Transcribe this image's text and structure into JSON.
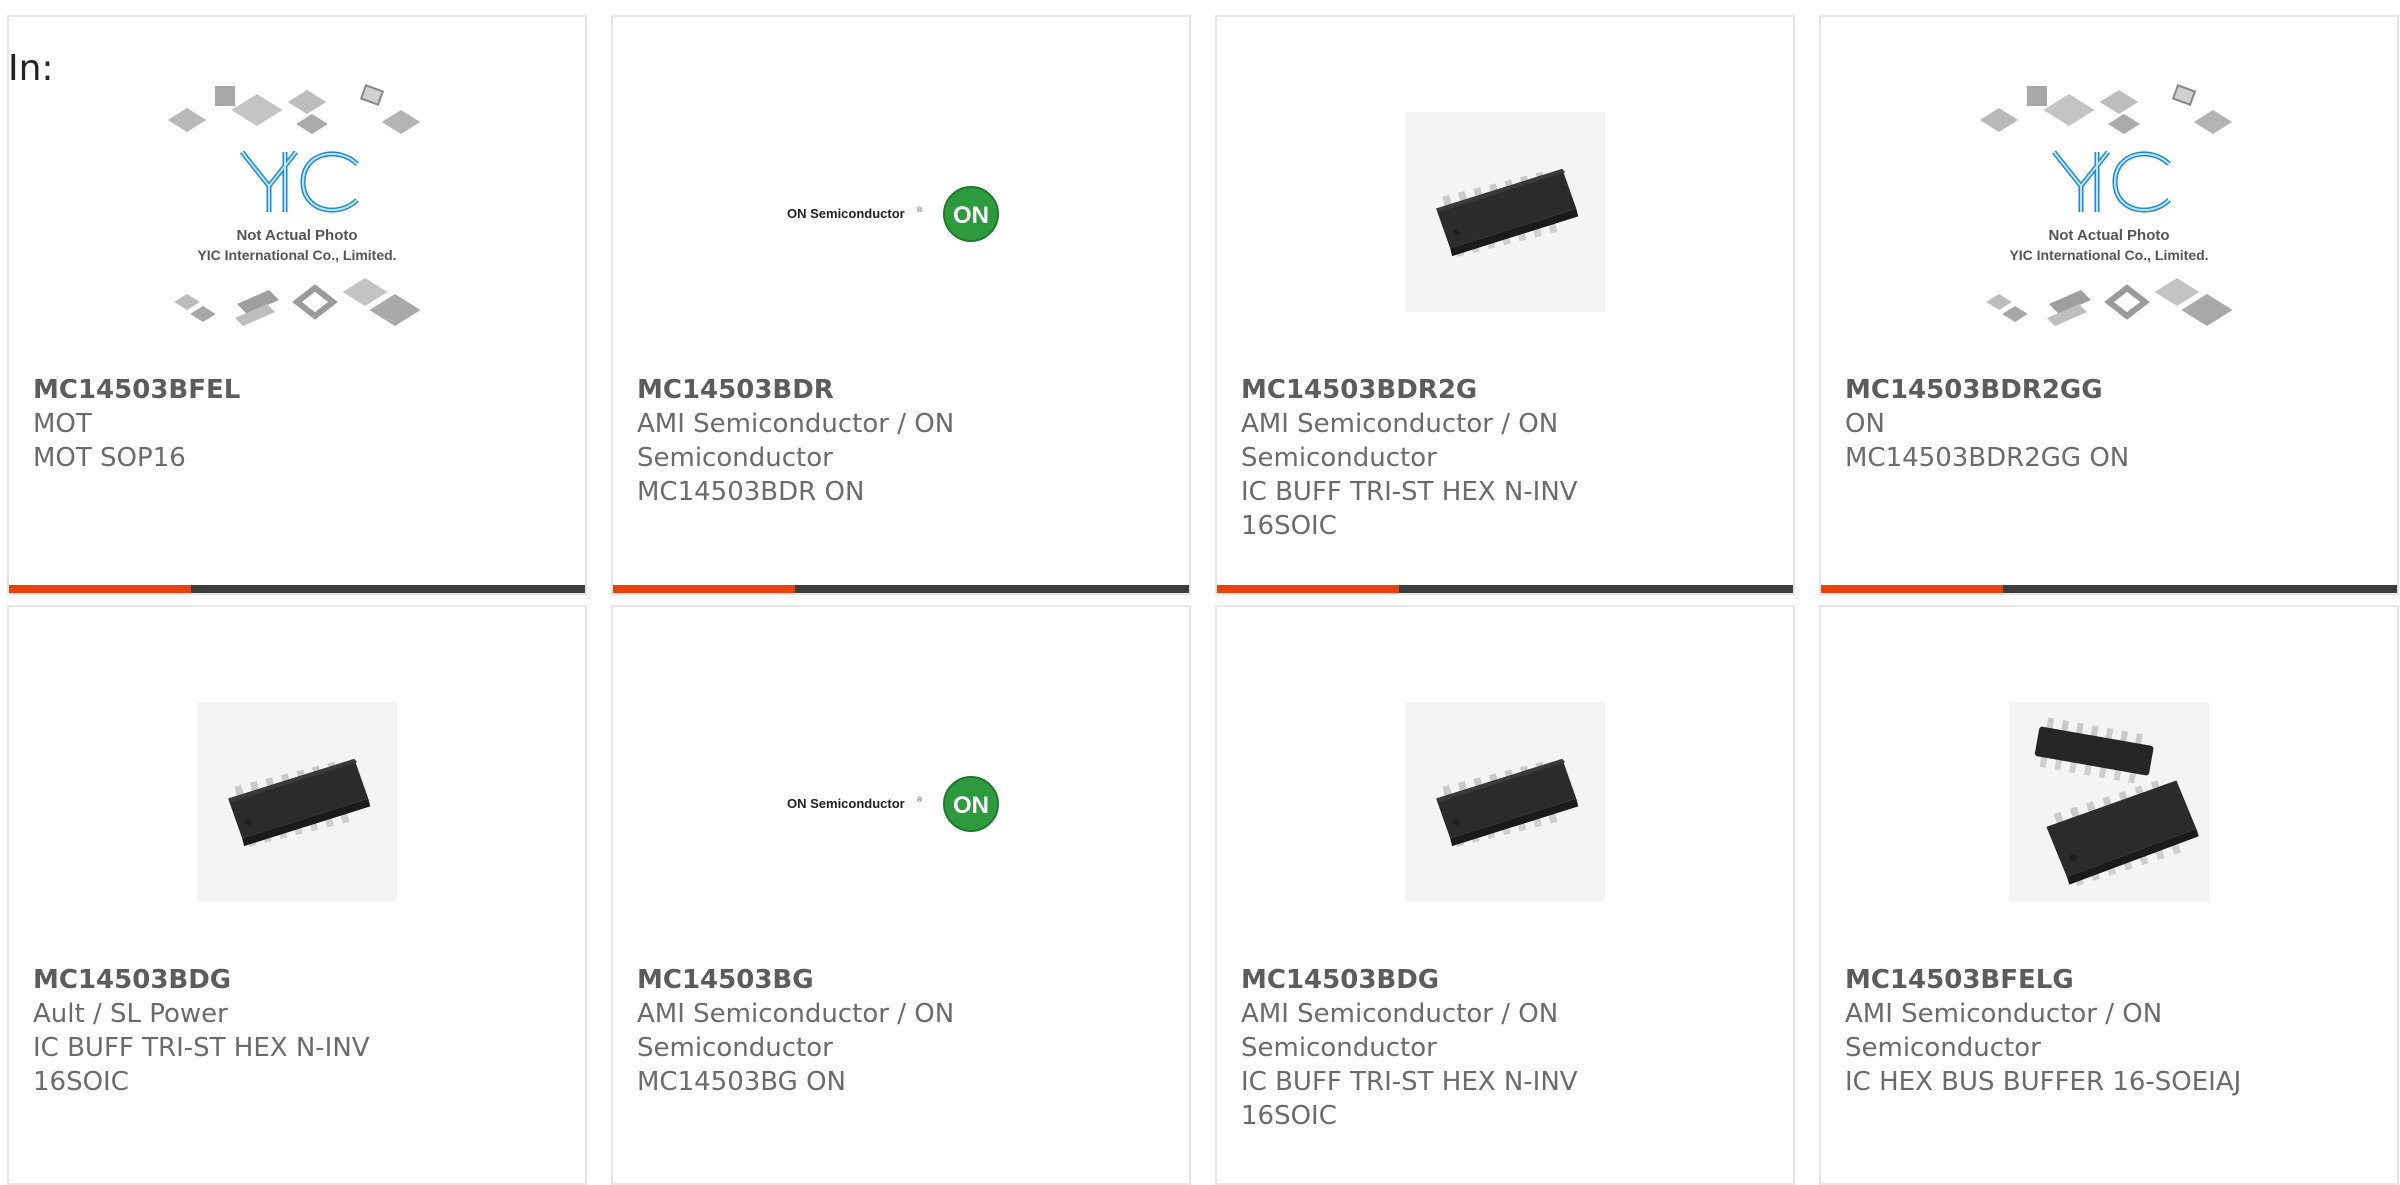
{
  "page": {
    "prefix_label": "In:"
  },
  "products": [
    {
      "part_number": "MC14503BFEL",
      "lines": [
        "MOT",
        "MOT SOP16"
      ],
      "image": "yic-placeholder"
    },
    {
      "part_number": "MC14503BDR",
      "lines": [
        "AMI Semiconductor / ON",
        "Semiconductor",
        "MC14503BDR ON"
      ],
      "image": "on-semi-logo"
    },
    {
      "part_number": "MC14503BDR2G",
      "lines": [
        "AMI Semiconductor / ON",
        "Semiconductor",
        "IC BUFF TRI-ST HEX N-INV",
        "16SOIC"
      ],
      "image": "soic-chip"
    },
    {
      "part_number": "MC14503BDR2GG",
      "lines": [
        "ON",
        "MC14503BDR2GG ON"
      ],
      "image": "yic-placeholder"
    },
    {
      "part_number": "MC14503BDG",
      "lines": [
        "Ault / SL Power",
        "IC BUFF TRI-ST HEX N-INV",
        "16SOIC"
      ],
      "image": "soic-chip"
    },
    {
      "part_number": "MC14503BG",
      "lines": [
        "AMI Semiconductor / ON",
        "Semiconductor",
        "MC14503BG ON"
      ],
      "image": "on-semi-logo"
    },
    {
      "part_number": "MC14503BDG",
      "lines": [
        "AMI Semiconductor / ON",
        "Semiconductor",
        "IC BUFF TRI-ST HEX N-INV",
        "16SOIC"
      ],
      "image": "soic-chip"
    },
    {
      "part_number": "MC14503BFELG",
      "lines": [
        "AMI Semiconductor / ON",
        "Semiconductor",
        "IC HEX BUS BUFFER 16-SOEIAJ"
      ],
      "image": "soeiaj-chips"
    }
  ],
  "image_text": {
    "yic_caption_1": "Not Actual Photo",
    "yic_caption_2": "YIC International Co., Limited.",
    "on_brand": "ON Semiconductor",
    "on_badge": "ON"
  },
  "colors": {
    "accent_orange": "#e8400f",
    "accent_dark": "#3d3d3d",
    "card_border": "#e6e6e6",
    "on_green": "#2e9a3e",
    "yic_blue": "#1b8ad0"
  }
}
